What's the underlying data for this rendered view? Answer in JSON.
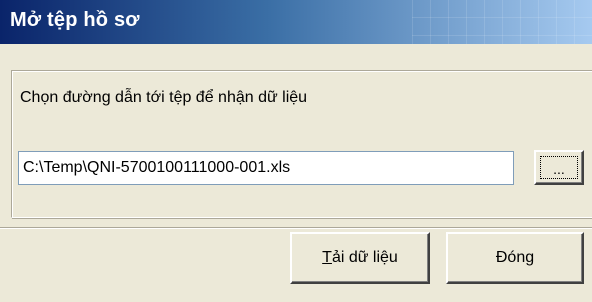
{
  "window": {
    "title": "Mở tệp hồ sơ"
  },
  "form": {
    "prompt": "Chọn đường dẫn tới tệp để nhận dữ liệu",
    "path_value": "C:\\Temp\\QNI-5700100111000-001.xls",
    "browse_label": "..."
  },
  "buttons": {
    "load": {
      "mnemonic": "T",
      "rest": "ải dữ liệu"
    },
    "close": {
      "pre": "Đón",
      "mnemonic": "g"
    }
  },
  "colors": {
    "titlebar_start": "#0a246a",
    "titlebar_end": "#a6caf0",
    "dialog_bg": "#ece9d8"
  }
}
